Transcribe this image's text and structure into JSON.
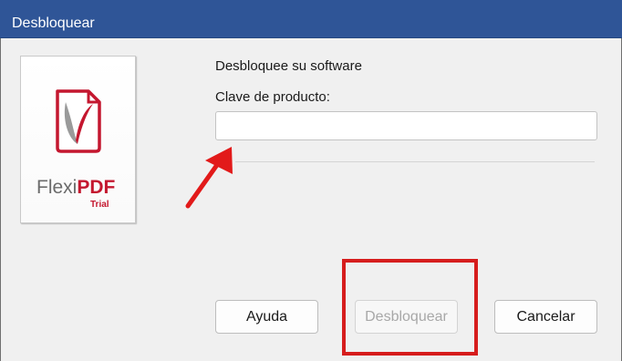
{
  "window": {
    "title": "Desbloquear"
  },
  "logo": {
    "brand_left": "Flexi",
    "brand_right": "PDF",
    "edition": "Trial"
  },
  "form": {
    "heading": "Desbloquee su software",
    "key_label": "Clave de producto:",
    "key_value": "",
    "key_placeholder": ""
  },
  "buttons": {
    "help": "Ayuda",
    "unlock": "Desbloquear",
    "cancel": "Cancelar"
  },
  "annotations": {
    "arrow_color": "#e21a1a",
    "highlight_color": "#d61d1d"
  },
  "colors": {
    "titlebar": "#2f5597",
    "brand_red": "#c4172f",
    "brand_gray": "#6b6b6b"
  }
}
